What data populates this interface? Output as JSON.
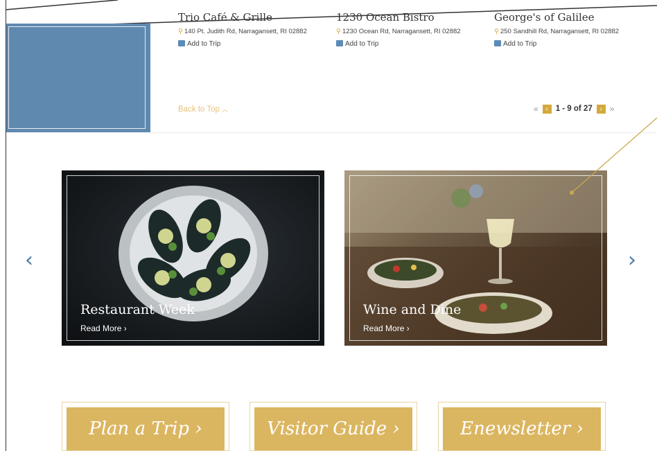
{
  "listings": [
    {
      "name": "Trio Café & Grille",
      "address": "140 Pt. Judith Rd, Narragansett, RI 02882",
      "add_to_trip": "Add to Trip"
    },
    {
      "name": "1230 Ocean Bistro",
      "address": "1230 Ocean Rd, Narragansett, RI 02882",
      "add_to_trip": "Add to Trip"
    },
    {
      "name": "George's of Galilee",
      "address": "250 Sandhill Rd, Narragansett, RI 02882",
      "add_to_trip": "Add to Trip"
    }
  ],
  "back_to_top": "Back to Top",
  "pagination": {
    "first": "«",
    "prev": "‹",
    "range": "1 - 9 of 27",
    "next": "›",
    "last": "»"
  },
  "carousel": {
    "prev_arrow": "‹",
    "next_arrow": "›",
    "cards": [
      {
        "title": "Restaurant Week",
        "more": "Read More ›"
      },
      {
        "title": "Wine and Dine",
        "more": "Read More ›"
      }
    ]
  },
  "cta": [
    {
      "label": "Plan a Trip ›"
    },
    {
      "label": "Visitor Guide ›"
    },
    {
      "label": "Enewsletter ›"
    }
  ],
  "icons": {
    "pin": "map-pin-icon",
    "bag": "suitcase-icon"
  },
  "colors": {
    "gold": "#dbb660",
    "blue": "#6089b0",
    "accent_blue": "#4a7aa8"
  }
}
